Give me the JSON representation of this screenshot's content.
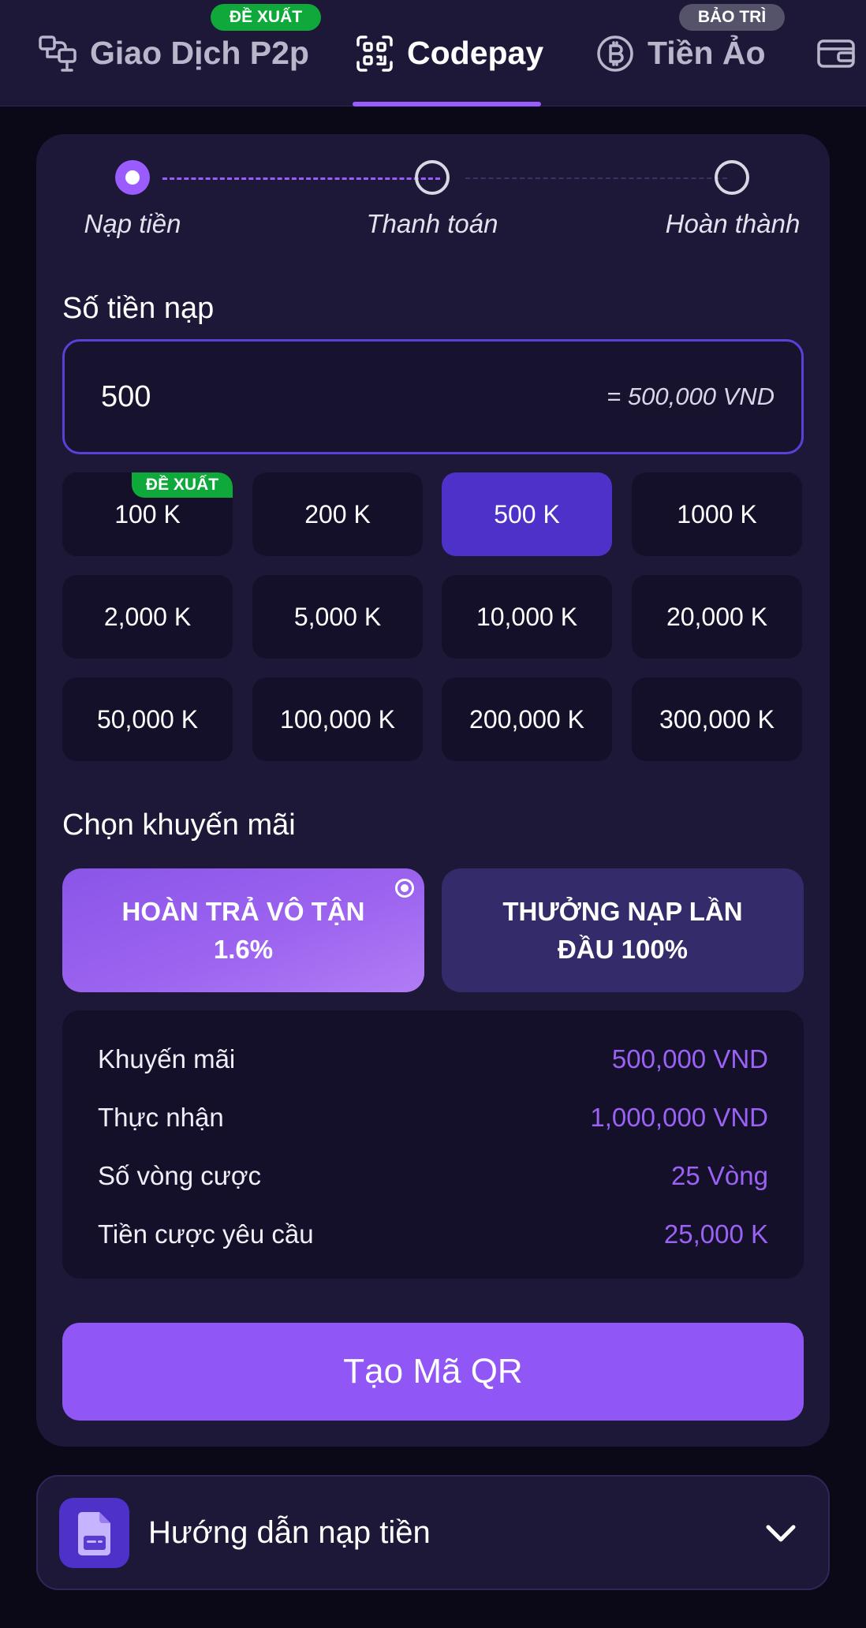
{
  "tabs": [
    {
      "label": "Giao Dịch P2p",
      "badge": "ĐỀ XUẤT",
      "icon": "p2p-transfer-icon"
    },
    {
      "label": "Codepay",
      "icon": "qr-scan-icon",
      "active": true
    },
    {
      "label": "Tiền Ảo",
      "badge": "BẢO TRÌ",
      "icon": "bitcoin-icon"
    },
    {
      "label": "",
      "icon": "wallet-icon"
    }
  ],
  "steps": [
    {
      "label": "Nạp tiền",
      "state": "active"
    },
    {
      "label": "Thanh toán",
      "state": "pending"
    },
    {
      "label": "Hoàn thành",
      "state": "pending"
    }
  ],
  "amount": {
    "title": "Số tiền nạp",
    "value": "500",
    "converted": "= 500,000 VND"
  },
  "quick_amounts": [
    {
      "label": "100 K",
      "badge": "ĐỀ XUẤT"
    },
    {
      "label": "200 K"
    },
    {
      "label": "500 K",
      "selected": true
    },
    {
      "label": "1000 K"
    },
    {
      "label": "2,000 K"
    },
    {
      "label": "5,000 K"
    },
    {
      "label": "10,000 K"
    },
    {
      "label": "20,000 K"
    },
    {
      "label": "50,000 K"
    },
    {
      "label": "100,000 K"
    },
    {
      "label": "200,000 K"
    },
    {
      "label": "300,000 K"
    }
  ],
  "promotion": {
    "title": "Chọn khuyến mãi",
    "options": [
      {
        "line1": "HOÀN TRẢ VÔ TẬN",
        "line2": "1.6%",
        "selected": true
      },
      {
        "line1": "THƯỞNG NẠP LẦN",
        "line2": "ĐẦU 100%"
      }
    ]
  },
  "summary": [
    {
      "label": "Khuyến mãi",
      "value": "500,000 VND"
    },
    {
      "label": "Thực nhận",
      "value": "1,000,000 VND"
    },
    {
      "label": "Số vòng cược",
      "value": "25 Vòng"
    },
    {
      "label": "Tiền cược yêu cầu",
      "value": "25,000 K"
    }
  ],
  "qr_button_label": "Tạo Mã QR",
  "guide_label": "Hướng dẫn nạp tiền",
  "colors": {
    "accent": "#9b5cff",
    "selected_amount": "#4e31c9",
    "badge_green": "#0fa83a",
    "badge_gray": "#55536a",
    "value_purple": "#9b62f5",
    "panel": "#1d1838",
    "background": "#0b0818"
  }
}
